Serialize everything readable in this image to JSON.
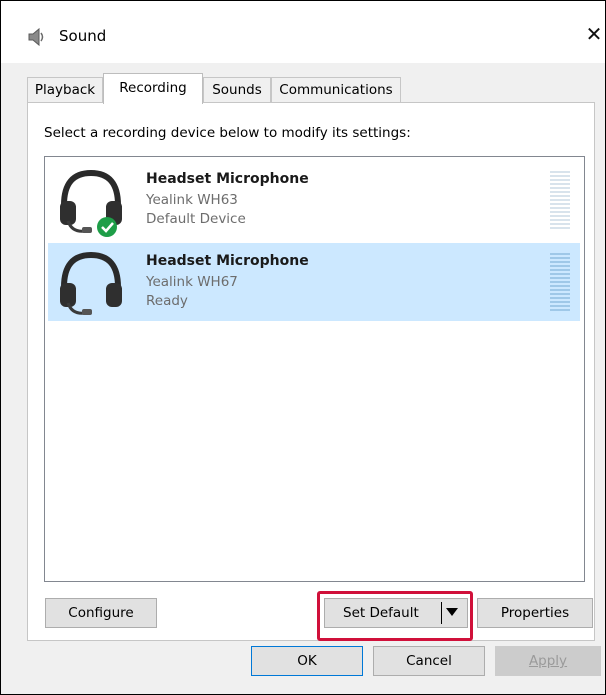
{
  "window": {
    "title": "Sound",
    "close_glyph": "✕",
    "icon": "speaker-icon"
  },
  "tabs": [
    {
      "label": "Playback",
      "active": false
    },
    {
      "label": "Recording",
      "active": true
    },
    {
      "label": "Sounds",
      "active": false
    },
    {
      "label": "Communications",
      "active": false
    }
  ],
  "instructions": "Select a recording device below to modify its settings:",
  "devices": [
    {
      "name": "Headset Microphone",
      "model": "Yealink WH63",
      "status": "Default Device",
      "selected": false,
      "is_default": true,
      "icon": "headset-icon"
    },
    {
      "name": "Headset Microphone",
      "model": "Yealink WH67",
      "status": "Ready",
      "selected": true,
      "is_default": false,
      "icon": "headset-icon"
    }
  ],
  "buttons": {
    "configure": "Configure",
    "set_default": "Set Default",
    "properties": "Properties",
    "ok": "OK",
    "cancel": "Cancel",
    "apply": "Apply"
  },
  "colors": {
    "selection": "#cce8ff",
    "highlight_box": "#d0103a",
    "default_check": "#1e9e48",
    "focus_border": "#0078d7"
  }
}
